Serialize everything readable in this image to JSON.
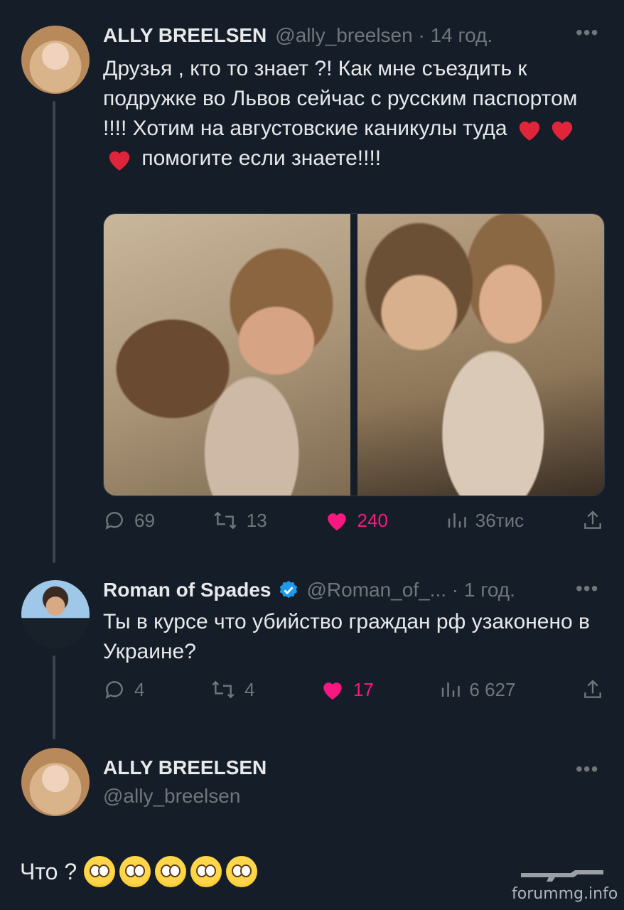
{
  "tweet1": {
    "author_name": "ALLY BREELSEN",
    "handle_time": "@ally_breelsen · 14 год.",
    "text_part1": "Друзья , кто то знает ?! Как мне съездить к подружке во Львов сейчас с русским паспортом !!!! Хотим на августовские каникулы туда",
    "text_part2": "помогите если знаете!!!!",
    "heart_emoji_count": 3,
    "replies": "69",
    "retweets": "13",
    "likes": "240",
    "views": "36тис"
  },
  "reply": {
    "author_name": "Roman of Spades",
    "verified": true,
    "handle_time": "@Roman_of_... · 1 год.",
    "text": "Ты в курсе что убийство граждан рф узаконено в Украине?",
    "replies": "4",
    "retweets": "4",
    "likes": "17",
    "views": "6 627"
  },
  "tweet3": {
    "author_name": "ALLY BREELSEN",
    "handle": "@ally_breelsen",
    "text": "Что ?"
  },
  "watermark": "forummg.info",
  "colors": {
    "background": "#151d28",
    "text": "#e7e9ea",
    "muted": "#71767b",
    "like": "#f91880",
    "verified": "#1d9bf0"
  }
}
